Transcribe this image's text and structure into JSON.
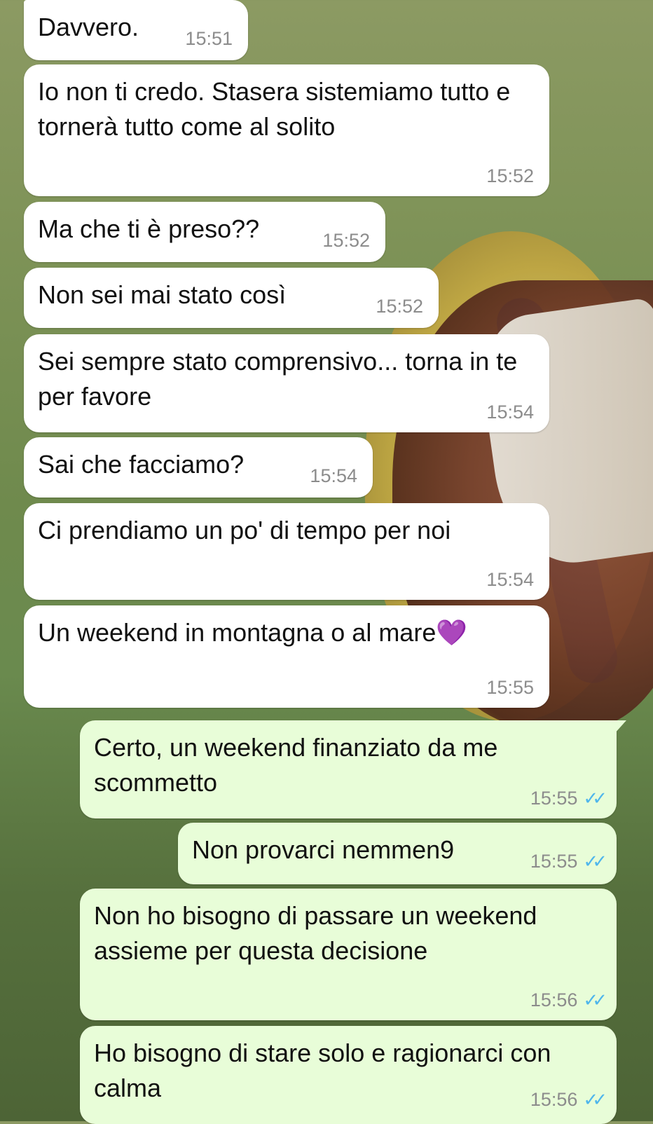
{
  "messages": [
    {
      "direction": "in",
      "text": "Davvero.",
      "time": "15:51"
    },
    {
      "direction": "in",
      "text": "Io non ti credo. Stasera sistemiamo tutto e tornerà tutto come al solito",
      "time": "15:52"
    },
    {
      "direction": "in",
      "text": "Ma che ti è preso??",
      "time": "15:52"
    },
    {
      "direction": "in",
      "text": "Non sei mai stato così",
      "time": "15:52"
    },
    {
      "direction": "in",
      "text": "Sei sempre stato comprensivo... torna in te per favore",
      "time": "15:54"
    },
    {
      "direction": "in",
      "text": "Sai che facciamo?",
      "time": "15:54"
    },
    {
      "direction": "in",
      "text": "Ci prendiamo un po' di tempo per noi",
      "time": "15:54"
    },
    {
      "direction": "in",
      "text": "Un weekend in montagna o al mare💜",
      "time": "15:55"
    },
    {
      "direction": "out",
      "text": "Certo, un weekend finanziato da me scommetto",
      "time": "15:55",
      "status": "read"
    },
    {
      "direction": "out",
      "text": "Non provarci nemmen9",
      "time": "15:55",
      "status": "read"
    },
    {
      "direction": "out",
      "text": "Non ho bisogno di passare un weekend assieme per questa decisione",
      "time": "15:56",
      "status": "read"
    },
    {
      "direction": "out",
      "text": "Ho bisogno di stare solo e ragionarci con calma",
      "time": "15:56",
      "status": "read"
    }
  ],
  "read_tick": "✓✓",
  "colors": {
    "incoming": "#ffffff",
    "outgoing": "#e8fdd8",
    "read_ticks": "#4fb6ec",
    "time": "#8c8c8c"
  }
}
